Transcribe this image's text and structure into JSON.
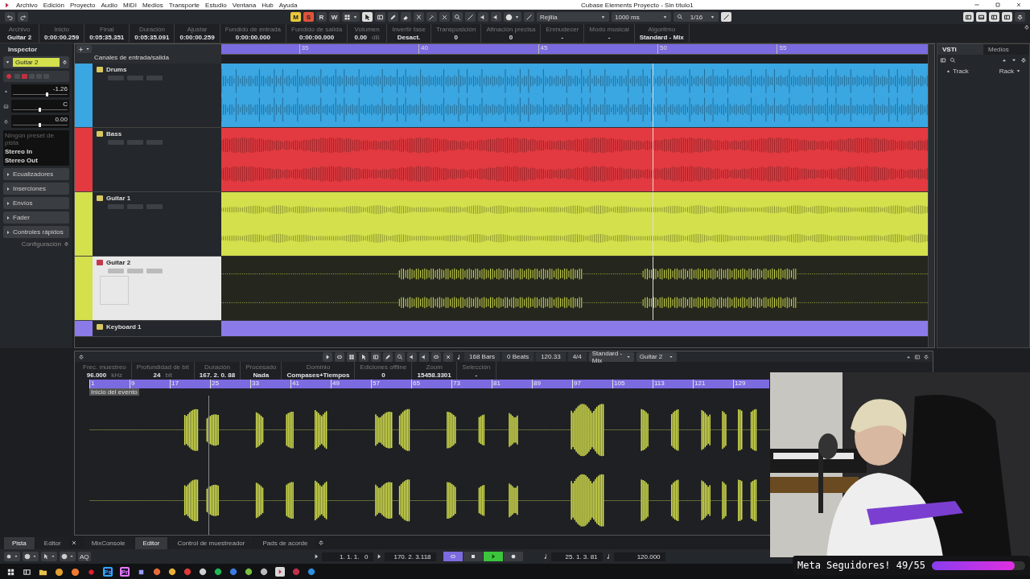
{
  "window": {
    "title": "Cubase Elements Proyecto - Sin título1"
  },
  "menu": [
    "Archivo",
    "Edición",
    "Proyecto",
    "Audio",
    "MIDI",
    "Medios",
    "Transporte",
    "Estudio",
    "Ventana",
    "Hub",
    "Ayuda"
  ],
  "toolbar": {
    "modes": [
      {
        "label": "M",
        "color": "#e8c93a"
      },
      {
        "label": "S",
        "color": "#e0533a"
      },
      {
        "label": "R",
        "color": "#3a3d42"
      },
      {
        "label": "W",
        "color": "#3a3d42"
      }
    ],
    "grid": "Rejilla",
    "grid_time": "1000 ms",
    "quantize": "1/16"
  },
  "info_line": [
    {
      "label": "Archivo",
      "value": "Guitar 2"
    },
    {
      "label": "Inicio",
      "value": "0:00:00.259"
    },
    {
      "label": "Final",
      "value": "0:05:35.351"
    },
    {
      "label": "Duración",
      "value": "0:05:35.091"
    },
    {
      "label": "Ajustar",
      "value": "0:00:00.259"
    },
    {
      "label": "Fundido de entrada",
      "value": "0:00:00.000"
    },
    {
      "label": "Fundido de salida",
      "value": "0:00:00.000"
    },
    {
      "label": "Volumen",
      "value": "0.00",
      "unit": "dB"
    },
    {
      "label": "Invertir fase",
      "value": "Desact."
    },
    {
      "label": "Transposición",
      "value": "0"
    },
    {
      "label": "Afinación precisa",
      "value": "0"
    },
    {
      "label": "Enmudecer",
      "value": "-"
    },
    {
      "label": "Modo musical",
      "value": "-"
    },
    {
      "label": "Algoritmo",
      "value": "Standard - Mix"
    }
  ],
  "inspector": {
    "tab": "Inspector",
    "track_name": "Guitar 2",
    "faders": [
      {
        "value": "-1.26",
        "level": 0.63
      },
      {
        "value": "C",
        "level": 0.5
      },
      {
        "value": "0.00",
        "level": 0.5
      }
    ],
    "routing": [
      "Ningún preset de pista",
      "Stereo In",
      "Stereo Out"
    ],
    "sections": [
      "Ecualizadores",
      "Inserciones",
      "Envíos",
      "Fader",
      "Controles rápidos"
    ],
    "settings": "Configuración"
  },
  "project": {
    "header": "Canales de entrada/salida",
    "ruler": [
      "35",
      "40",
      "45",
      "50",
      "55"
    ],
    "tracks": [
      {
        "name": "Drums",
        "color": "#3aa6e2",
        "selected": false
      },
      {
        "name": "Bass",
        "color": "#e23a40",
        "selected": false
      },
      {
        "name": "Guitar 1",
        "color": "#d4e04c",
        "selected": false
      },
      {
        "name": "Guitar 2",
        "color": "#d4e04c",
        "selected": true
      },
      {
        "name": "Keyboard 1",
        "color": "#8a7be8",
        "selected": false
      }
    ]
  },
  "right_zone": {
    "tabs": [
      {
        "label": "VSTi",
        "selected": true
      },
      {
        "label": "Medios",
        "selected": false
      }
    ],
    "items": [
      "Track",
      "Rack"
    ]
  },
  "editor": {
    "toolbar": {
      "bars": "168 Bars",
      "beats": "0 Beats",
      "tempo": "120.33",
      "signature": "4/4",
      "algorithm": "Standard - Mix",
      "track": "Guitar 2"
    },
    "info": [
      {
        "label": "Frec. muestreo",
        "value": "96.000",
        "unit": "kHz"
      },
      {
        "label": "Profundidad de bit",
        "value": "24",
        "unit": "bit"
      },
      {
        "label": "Duración",
        "value": "167. 2. 0. 88"
      },
      {
        "label": "Procesado",
        "value": "Nada"
      },
      {
        "label": "Dominio",
        "value": "Compases+Tiempos"
      },
      {
        "label": "Ediciones offline",
        "value": "0"
      },
      {
        "label": "Zoom",
        "value": "15458.3301"
      },
      {
        "label": "Selección",
        "value": "-"
      }
    ],
    "ruler": [
      "1",
      "9",
      "17",
      "25",
      "33",
      "41",
      "49",
      "57",
      "65",
      "73",
      "81",
      "89",
      "97",
      "105",
      "113",
      "121",
      "129"
    ],
    "event_label": "Inicio del evento"
  },
  "lower_tabs": {
    "left": [
      {
        "label": "Pista",
        "selected": true
      },
      {
        "label": "Editor",
        "selected": false
      }
    ],
    "right": [
      {
        "label": "MixConsole",
        "selected": false
      },
      {
        "label": "Editor",
        "selected": true
      },
      {
        "label": "Control de muestreador",
        "selected": false
      },
      {
        "label": "Pads de acorde",
        "selected": false
      }
    ]
  },
  "transport": {
    "quantize_label": "AQ",
    "left_locator": "1. 1. 1.   0",
    "right_locator": "170. 2. 3.118",
    "buttons": [
      {
        "kind": "cycle",
        "on": true
      },
      {
        "kind": "stop",
        "on": false
      },
      {
        "kind": "play",
        "on": true
      },
      {
        "kind": "record",
        "on": false
      }
    ],
    "position": "25. 1. 3. 81",
    "tempo": "120.000"
  },
  "taskbar": [
    {
      "kind": "start"
    },
    {
      "kind": "taskview"
    },
    {
      "kind": "folder"
    },
    {
      "kind": "chrome"
    },
    {
      "kind": "firefox"
    },
    {
      "kind": "opera"
    },
    {
      "kind": "app",
      "label": "Ps",
      "color": "#31a8ff"
    },
    {
      "kind": "app",
      "label": "Pr",
      "color": "#ea77ff"
    },
    {
      "kind": "app",
      "color": "#9999ff"
    },
    {
      "kind": "spot",
      "color": "#e86a3a"
    },
    {
      "kind": "spot",
      "color": "#e8b03a"
    },
    {
      "kind": "spot",
      "color": "#e03a3a"
    },
    {
      "kind": "spot",
      "color": "#cfcfcf"
    },
    {
      "kind": "spot",
      "color": "#1db954"
    },
    {
      "kind": "spot",
      "color": "#3a7be0"
    },
    {
      "kind": "spot",
      "color": "#7bc043"
    },
    {
      "kind": "spot",
      "color": "#bbbbbb"
    },
    {
      "kind": "cubase"
    },
    {
      "kind": "spot",
      "color": "#c0304a"
    },
    {
      "kind": "spot",
      "color": "#2d8ee0"
    }
  ],
  "stream_overlay": {
    "kind": "picture",
    "goal": "Meta Seguidores! 49/55",
    "level": 0.89
  }
}
